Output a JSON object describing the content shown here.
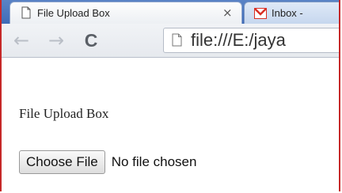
{
  "browser": {
    "tabs": [
      {
        "title": "File Upload Box",
        "active": true,
        "close_glyph": "×",
        "icon": "page-icon"
      },
      {
        "title": "Inbox -",
        "active": false,
        "icon": "gmail-icon"
      }
    ],
    "nav": {
      "back_glyph": "←",
      "forward_glyph": "→",
      "reload_glyph": "C"
    },
    "address": "file:///E:/jaya"
  },
  "page": {
    "heading": "File Upload Box",
    "file_input": {
      "button_label": "Choose File",
      "status": "No file chosen"
    }
  },
  "colors": {
    "frame": "#c62828",
    "tabstrip": "#4a76bf",
    "gmail_red": "#d93025"
  }
}
